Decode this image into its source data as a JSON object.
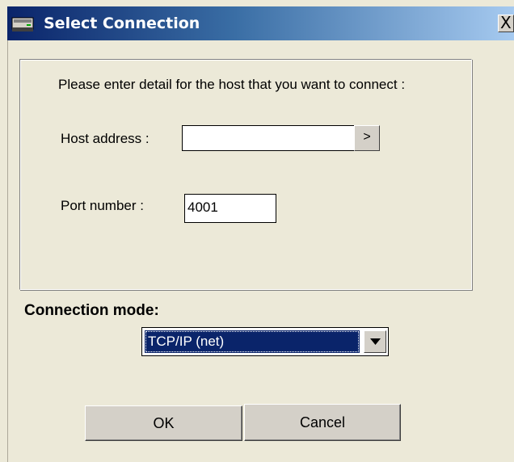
{
  "window": {
    "title": "Select Connection",
    "close_label": "X",
    "title_icon": "computer-drive-icon"
  },
  "form": {
    "instructions": "Please enter detail for the host that you want to connect :",
    "host_label": "Host address :",
    "host_value": "",
    "browse_label": ">",
    "port_label": "Port number :",
    "port_value": "4001"
  },
  "connection": {
    "label": "Connection mode:",
    "selected": "TCP/IP (net)"
  },
  "buttons": {
    "ok": "OK",
    "cancel": "Cancel"
  },
  "colors": {
    "title_bar_start": "#0a246a",
    "title_bar_end": "#a6caf0",
    "dialog_bg": "#ece9d8",
    "selection": "#0a246a"
  }
}
